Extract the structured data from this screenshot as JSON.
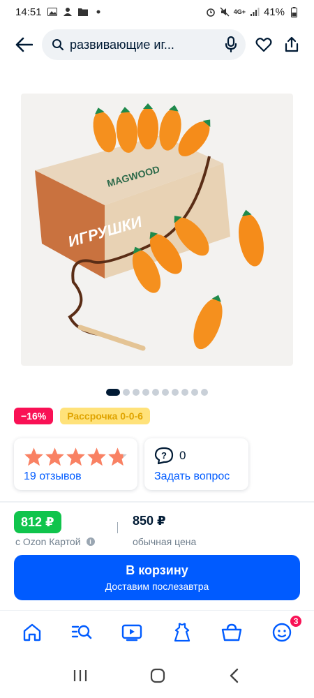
{
  "status_bar": {
    "time": "14:51",
    "signal_label": "4G+",
    "battery_percent": "41%"
  },
  "header": {
    "search_text": "развивающие иг..."
  },
  "gallery": {
    "image_alt": "Игрушки MAGWOOD — морковки на шнурке",
    "box_brand": "MAGWOOD",
    "box_word": "ИГРУШКИ",
    "slide_count": 10,
    "active_slide": 0
  },
  "badges": {
    "discount": "−16%",
    "installment": "Рассрочка 0-0-6"
  },
  "rating_card": {
    "stars": 5,
    "reviews_label": "19 отзывов"
  },
  "question_card": {
    "count": "0",
    "ask_label": "Задать вопрос"
  },
  "price": {
    "ozon_card_price": "812 ₽",
    "ozon_card_label": "с Ozon Картой",
    "regular_price": "850 ₽",
    "regular_label": "обычная цена"
  },
  "cart_button": {
    "label": "В корзину",
    "delivery": "Доставим послезавтра"
  },
  "bottom_nav": {
    "profile_badge": "3"
  },
  "colors": {
    "accent": "#005bff",
    "price_green": "#10c44c",
    "discount_red": "#f91155",
    "star": "#f98163"
  }
}
